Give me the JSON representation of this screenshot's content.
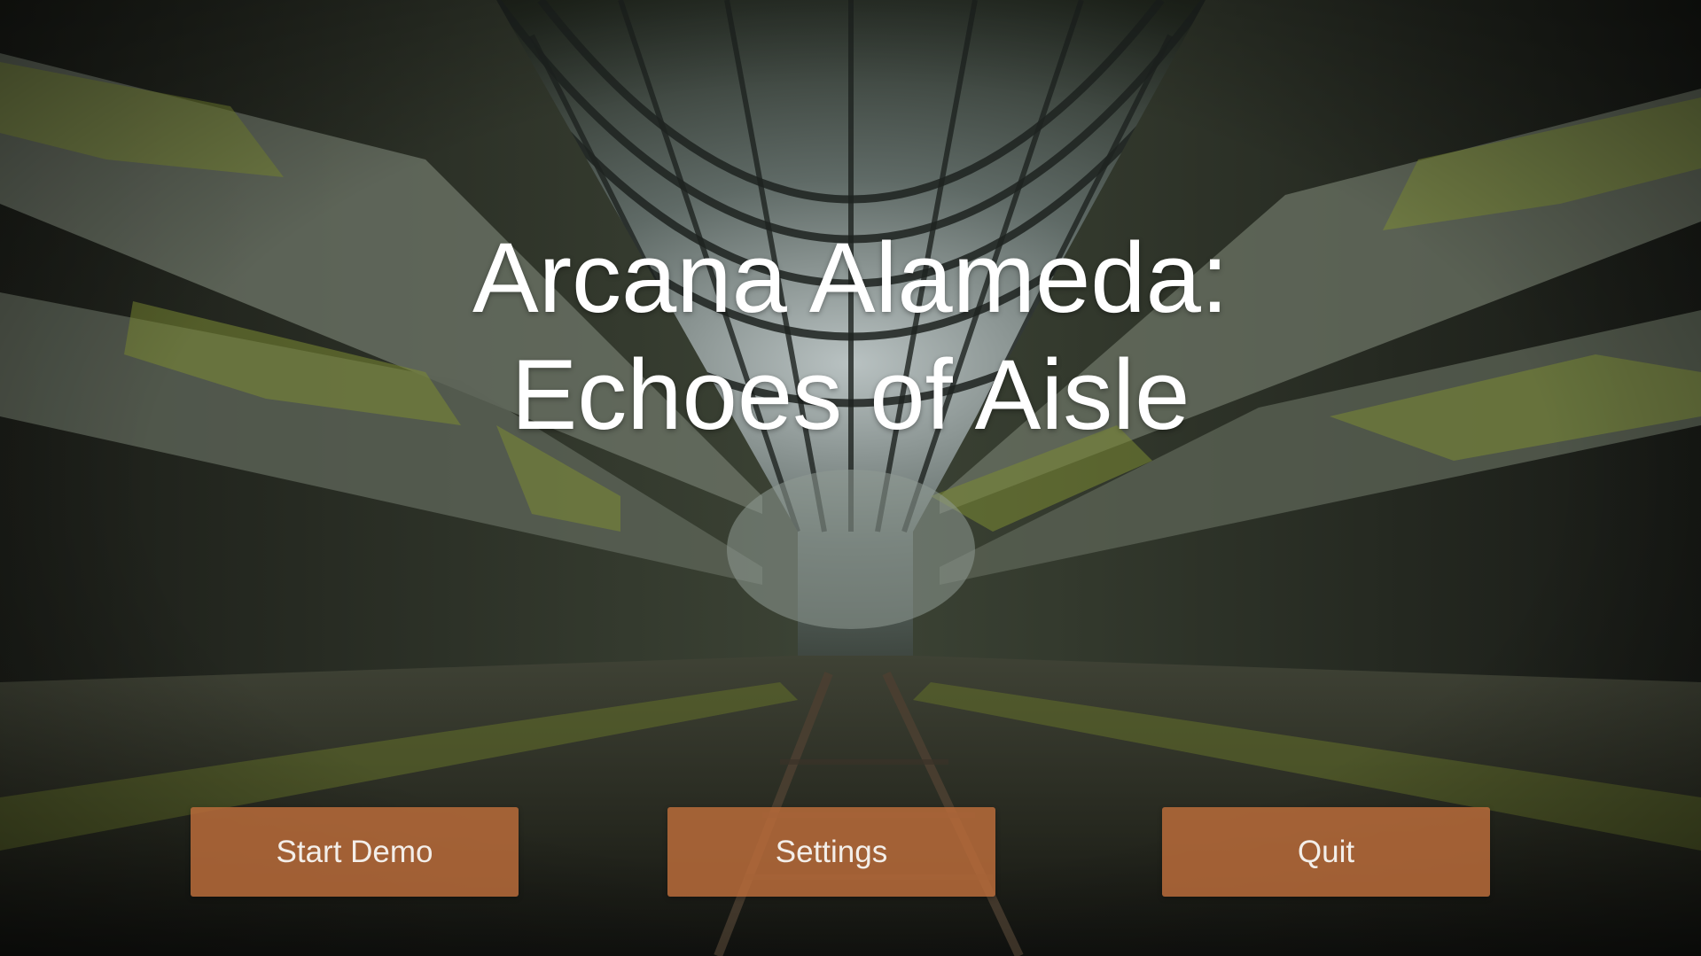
{
  "title": {
    "line1": "Arcana Alameda:",
    "line2": "Echoes of Aisle"
  },
  "menu": {
    "start_label": "Start Demo",
    "settings_label": "Settings",
    "quit_label": "Quit"
  },
  "colors": {
    "button_fill": "#b86b3a",
    "title_text": "#ffffff"
  }
}
